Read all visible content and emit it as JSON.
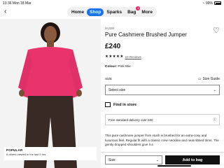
{
  "status": {
    "time": "13:36",
    "date": "Mon 18 Mar",
    "battery": "99%"
  },
  "nav": {
    "back": "‹",
    "tabs": [
      {
        "label": "Home",
        "active": false
      },
      {
        "label": "Shop",
        "active": true
      },
      {
        "label": "Sparks",
        "active": false
      },
      {
        "label": "Bag",
        "active": false,
        "badge": "1"
      },
      {
        "label": "More",
        "active": false
      }
    ]
  },
  "product": {
    "brand": "HUSH",
    "title": "Pure Cashmere Brushed Jumper",
    "price": "£240",
    "stars": "★★★★★",
    "reviews": "10 Reviews",
    "colour_label": "Colour:",
    "colour_value": "Pink Mix",
    "size_label": "SIZE",
    "size_guide": "Size Guide",
    "size_placeholder": "Select size",
    "find_in_store": "Find in store",
    "delivery": "Free standard delivery over £60",
    "description": "This pure cashmere jumper from Hush is brushed for an extra-cosy and luxurious feel. Regular fit with a classic crew neckline and neat ribbed trims. The gently dropped shoulders give it a"
  },
  "popular": {
    "title": "POPULAR",
    "subtitle": "6 others viewed in the last 5 hrs"
  },
  "bottom": {
    "size": "Size",
    "add": "Add to bag"
  },
  "colors": {
    "accent": "#1a73e8",
    "jumper": "#e8336d",
    "trousers": "#3a2a25"
  }
}
